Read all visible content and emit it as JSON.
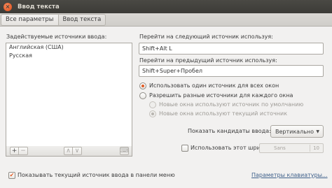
{
  "window": {
    "title": "Ввод текста",
    "close_glyph": "×"
  },
  "nav": {
    "back_label": "Все параметры",
    "current_label": "Ввод текста"
  },
  "sources": {
    "heading": "Задействуемые источники ввода:",
    "items": [
      "Английская (США)",
      "Русская"
    ],
    "add_glyph": "+",
    "remove_glyph": "−",
    "up_glyph": "∧",
    "down_glyph": "∨",
    "keyboard_glyph": "⌨"
  },
  "shortcuts": {
    "next_label": "Перейти на следующий источник используя:",
    "next_value": "Shift+Alt L",
    "prev_label": "Перейти на предыдущий источник используя:",
    "prev_value": "Shift+Super+Пробел"
  },
  "mode": {
    "same_label": "Использовать один источник для всех окон",
    "different_label": "Разрешить разные источники для каждого окна",
    "new_default_label": "Новые окна используют источник по умолчанию",
    "new_current_label": "Новые окна используют текущий источник"
  },
  "candidates": {
    "label": "Показать кандидаты ввода:",
    "value": "Вертикально",
    "arrow_glyph": "▼"
  },
  "font": {
    "label": "Использовать этот шрифт:",
    "name": "Sans",
    "size": "10"
  },
  "bottom": {
    "show_current_label": "Показывать текущий источник ввода в панели меню",
    "check_glyph": "✔",
    "keyboard_settings_link": "Параметры клавиатуры..."
  },
  "colors": {
    "accent": "#e05a23",
    "titlebar": "#3c3b37",
    "background": "#f2f1f0"
  }
}
